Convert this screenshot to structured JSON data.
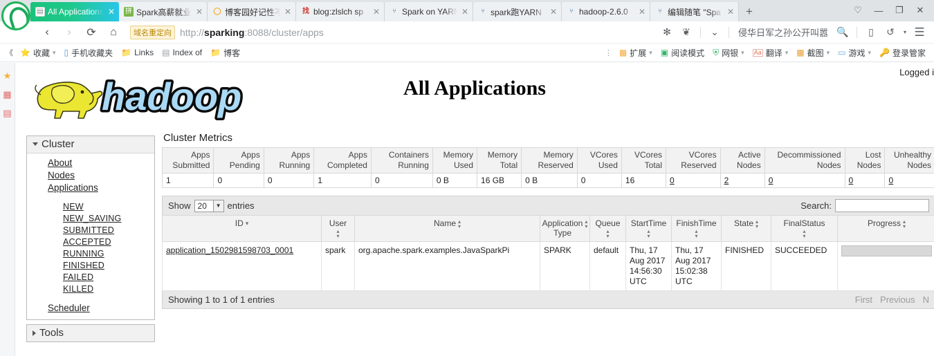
{
  "browser": {
    "tabs": [
      {
        "title": "All Applications",
        "favicon": "page-icon",
        "active": true
      },
      {
        "title": "Spark高薪就业",
        "favicon": "green-square-icon",
        "active": false
      },
      {
        "title": "博客园好记性不",
        "favicon": "orange-circle-icon",
        "active": false
      },
      {
        "title": "blog:zlslch sp",
        "favicon": "red-zhao-icon",
        "active": false
      },
      {
        "title": "Spark on YARN",
        "favicon": "blue-bird-icon",
        "active": false
      },
      {
        "title": "spark跑YARN",
        "favicon": "blue-bird-icon",
        "active": false
      },
      {
        "title": "hadoop-2.6.0",
        "favicon": "blue-bird-icon",
        "active": false
      },
      {
        "title": "编辑随笔 \"Spa",
        "favicon": "blue-bird-icon",
        "active": false
      }
    ],
    "new_tab_label": "+",
    "window_controls": {
      "pin": "♡",
      "minimize": "—",
      "maximize": "❐",
      "close": "✕"
    },
    "nav": {
      "back": "‹",
      "forward": "›",
      "reload": "⟳",
      "home": "⌂",
      "redirect_chip": "域名重定向",
      "url_scheme": "http://",
      "url_host": "sparking",
      "url_rest": ":8088/cluster/apps",
      "search_hint": "侵华日军之孙公开叫嚣",
      "icons": [
        "sync-icon",
        "leaf-icon",
        "chevron-down-icon",
        "search-icon",
        "mobile-icon",
        "history-icon",
        "menu-icon"
      ]
    },
    "bookmarks": {
      "left_arrow": "《",
      "items": [
        {
          "label": "收藏",
          "icon": "star-folder-icon",
          "has_caret": true
        },
        {
          "label": "手机收藏夹",
          "icon": "phone-icon",
          "has_caret": false
        },
        {
          "label": "Links",
          "icon": "folder-icon",
          "has_caret": false
        },
        {
          "label": "Index of",
          "icon": "page-icon",
          "has_caret": false
        },
        {
          "label": "博客",
          "icon": "folder-icon",
          "has_caret": false
        }
      ],
      "right_items": [
        {
          "label": "扩展",
          "icon": "extension-icon",
          "has_caret": true
        },
        {
          "label": "阅读模式",
          "icon": "reader-icon",
          "has_caret": false
        },
        {
          "label": "网银",
          "icon": "shield-icon",
          "has_caret": true
        },
        {
          "label": "翻译",
          "icon": "translate-icon",
          "has_caret": true
        },
        {
          "label": "截图",
          "icon": "screenshot-icon",
          "has_caret": true
        },
        {
          "label": "游戏",
          "icon": "game-icon",
          "has_caret": true
        },
        {
          "label": "登录管家",
          "icon": "key-icon",
          "has_caret": false
        }
      ]
    },
    "left_rail_icons": [
      "star-icon",
      "media-icon",
      "download-icon"
    ]
  },
  "page": {
    "logged_in": "Logged i",
    "title": "All Applications",
    "logo_alt": "hadoop"
  },
  "sidebar": {
    "cluster": {
      "heading": "Cluster",
      "links": [
        "About",
        "Nodes",
        "Applications"
      ],
      "app_states": [
        "NEW",
        "NEW_SAVING",
        "SUBMITTED",
        "ACCEPTED",
        "RUNNING",
        "FINISHED",
        "FAILED",
        "KILLED"
      ],
      "scheduler": "Scheduler"
    },
    "tools": {
      "heading": "Tools"
    }
  },
  "metrics": {
    "title": "Cluster Metrics",
    "headers": [
      "Apps Submitted",
      "Apps Pending",
      "Apps Running",
      "Apps Completed",
      "Containers Running",
      "Memory Used",
      "Memory Total",
      "Memory Reserved",
      "VCores Used",
      "VCores Total",
      "VCores Reserved",
      "Active Nodes",
      "Decommissioned Nodes",
      "Lost Nodes",
      "Unhealthy Nodes"
    ],
    "values": [
      "1",
      "0",
      "0",
      "1",
      "0",
      "0 B",
      "16 GB",
      "0 B",
      "0",
      "16",
      "0",
      "2",
      "0",
      "0",
      "0"
    ],
    "linked": [
      false,
      false,
      false,
      false,
      false,
      false,
      false,
      false,
      false,
      false,
      true,
      true,
      true,
      true,
      true
    ]
  },
  "datatable": {
    "show_label": "Show",
    "entries_value": "20",
    "entries_label": "entries",
    "search_label": "Search:",
    "search_value": "",
    "search_placeholder": "",
    "info": "Showing 1 to 1 of 1 entries",
    "pager": [
      "First",
      "Previous",
      "N"
    ],
    "columns": [
      {
        "label": "ID",
        "sort": "desc"
      },
      {
        "label": "User",
        "sort": "both"
      },
      {
        "label": "Name",
        "sort": "both"
      },
      {
        "label": "Application Type",
        "sort": "both"
      },
      {
        "label": "Queue",
        "sort": "both"
      },
      {
        "label": "StartTime",
        "sort": "both"
      },
      {
        "label": "FinishTime",
        "sort": "both"
      },
      {
        "label": "State",
        "sort": "both"
      },
      {
        "label": "FinalStatus",
        "sort": "both"
      },
      {
        "label": "Progress",
        "sort": "both"
      }
    ],
    "rows": [
      {
        "id": "application_1502981598703_0001",
        "user": "spark",
        "name": "org.apache.spark.examples.JavaSparkPi",
        "app_type": "SPARK",
        "queue": "default",
        "start_time": "Thu, 17 Aug 2017 14:56:30 UTC",
        "finish_time": "Thu, 17 Aug 2017 15:02:38 UTC",
        "state": "FINISHED",
        "final_status": "SUCCEEDED",
        "progress": 0
      }
    ]
  },
  "colors": {
    "tab_active_start": "#19c27c",
    "tab_active_end": "#29c6e8",
    "brand_green": "#1fb25a",
    "panel_head": "#f1f1f1",
    "table_head": "#f2f2f2"
  }
}
